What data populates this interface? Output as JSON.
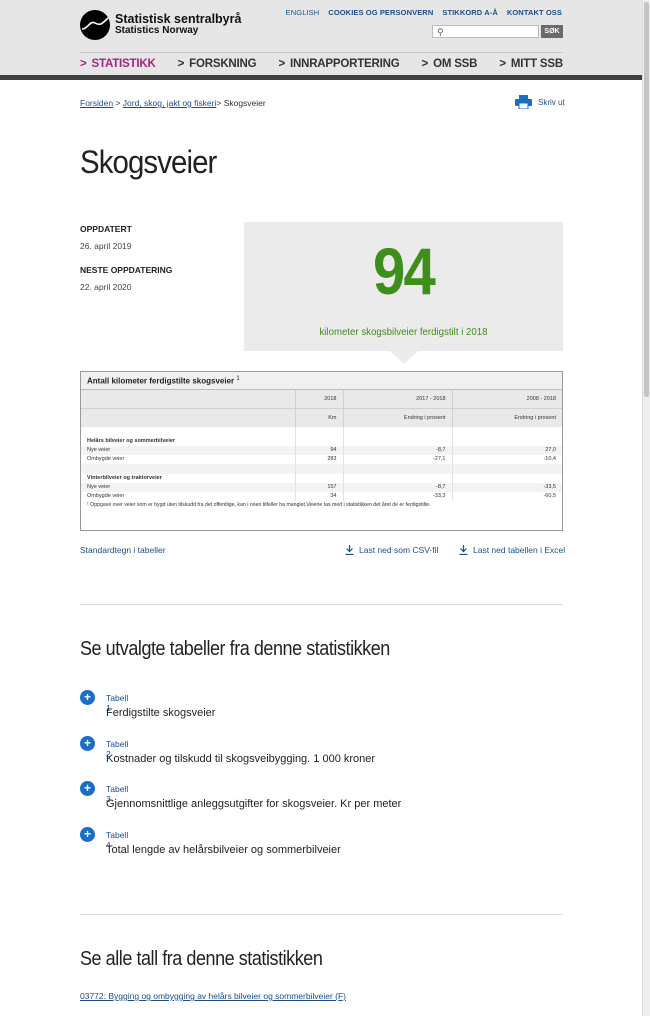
{
  "header": {
    "logo_line1": "Statistisk sentralbyrå",
    "logo_line2": "Statistics Norway",
    "top_links": [
      "ENGLISH",
      "COOKIES OG PERSONVERN",
      "STIKKORD A-Å",
      "KONTAKT OSS"
    ],
    "search_placeholder": "",
    "search_button": "SØK",
    "nav": [
      {
        "label": "STATISTIKK",
        "active": true
      },
      {
        "label": "FORSKNING",
        "active": false
      },
      {
        "label": "INNRAPPORTERING",
        "active": false
      },
      {
        "label": "OM SSB",
        "active": false
      },
      {
        "label": "MITT SSB",
        "active": false
      }
    ]
  },
  "breadcrumb": {
    "home": "Forsiden",
    "sep": ">",
    "parent": "Jord, skog, jakt og fiskeri",
    "current": "Skogsveier"
  },
  "print_label": "Skriv ut",
  "page_title": "Skogsveier",
  "meta": {
    "updated_label": "OPPDATERT",
    "updated_value": "26. april 2019",
    "next_label": "NESTE OPPDATERING",
    "next_value": "22. april 2020"
  },
  "key_figure": {
    "value": "94",
    "description": "kilometer skogsbilveier ferdigstilt i 2018"
  },
  "table": {
    "caption": "Antall kilometer ferdigstilte skogsveier",
    "caption_note": "1",
    "col_headers": [
      "2018",
      "2017 - 2018",
      "2008 - 2018"
    ],
    "col_units": [
      "Km",
      "Endring i prosent",
      "Endring i prosent"
    ],
    "groups": [
      {
        "name": "Helårs bilveier og sommerbilveier",
        "rows": [
          {
            "label": "Nye veier",
            "values": [
              "94",
              "-8,7",
              "27,0"
            ]
          },
          {
            "label": "Ombygde veier",
            "values": [
              "283",
              "-27,1",
              "-10,4"
            ]
          }
        ]
      },
      {
        "name": "Vinterbilveier og traktorveier",
        "rows": [
          {
            "label": "Nye veier",
            "values": [
              "157",
              "-8,7",
              "-33,5"
            ]
          },
          {
            "label": "Ombygde veier",
            "values": [
              "34",
              "-33,3",
              "-60,5"
            ]
          }
        ]
      }
    ],
    "footnote": "¹ Oppgave over veier som er bygd uten tilskudd fra det offentlige, kan i noen tilfeller ha manglet.Veiene tas med i statistikken det året de er ferdigstilte."
  },
  "below_table": {
    "std_signs": "Standardtegn i tabeller",
    "csv": "Last ned som CSV-fil",
    "excel": "Last ned tabellen i Excel"
  },
  "selected_tables": {
    "heading": "Se utvalgte tabeller fra denne statistikken",
    "items": [
      {
        "number": "Tabell 1",
        "title": "Ferdigstilte skogsveier"
      },
      {
        "number": "Tabell 2",
        "title": "Kostnader og tilskudd til skogsveibygging. 1 000 kroner"
      },
      {
        "number": "Tabell 3",
        "title": "Gjennomsnittlige anleggsutgifter for skogsveier. Kr per meter"
      },
      {
        "number": "Tabell 4",
        "title": "Total lengde av helårsbilveier og sommerbilveier"
      }
    ]
  },
  "all_figures": {
    "heading": "Se alle tall fra denne statistikken",
    "link": "03772: Bygging og ombygging av helårs bilveier og sommerbilveier (F)"
  },
  "colors": {
    "accent_link": "#1a4d8c",
    "nav_active": "#a4257e",
    "key_figure": "#3e8e1b",
    "plus_button": "#1a6fc4"
  }
}
